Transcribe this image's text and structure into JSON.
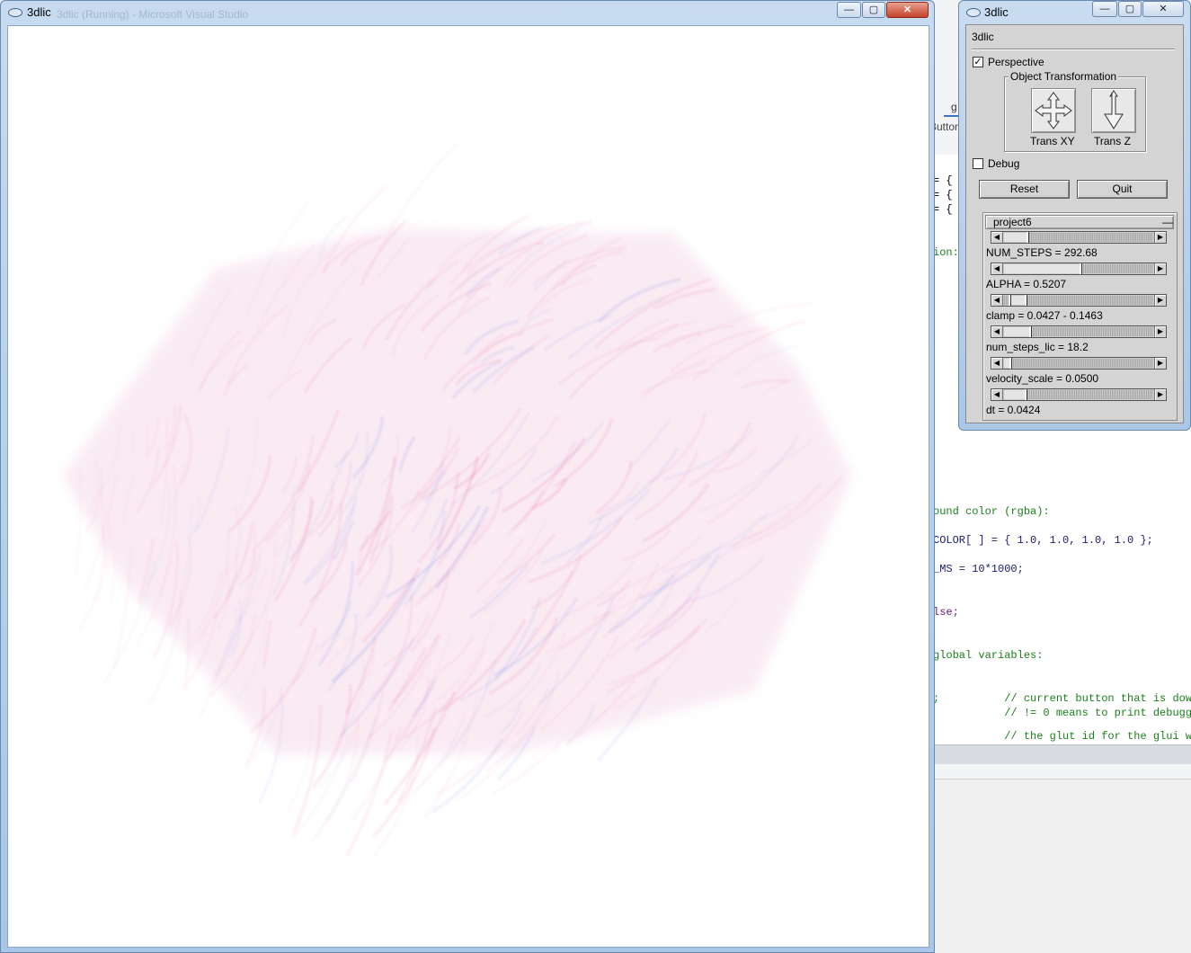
{
  "main_window": {
    "title": "3dlic",
    "ghost_title": "3dlic (Running) - Microsoft Visual Studio",
    "buttons": {
      "minimize": "—",
      "maximize": "▢",
      "close": "✕"
    }
  },
  "glui_window": {
    "title": "3dlic",
    "panel_title": "3dlic",
    "buttons": {
      "minimize": "—",
      "maximize": "▢",
      "close": "✕"
    },
    "perspective": {
      "label": "Perspective",
      "checked": true,
      "mark": "✓"
    },
    "transform_group": {
      "title": "Object Transformation",
      "trans_xy": "Trans XY",
      "trans_z": "Trans Z"
    },
    "debug": {
      "label": "Debug",
      "checked": false
    },
    "reset_label": "Reset",
    "quit_label": "Quit",
    "rollout": {
      "title": "project6",
      "collapse_glyph": "—",
      "sliders": [
        {
          "label": "NUM_STEPS = 292.68",
          "fraction": 0.16
        },
        {
          "label": "ALPHA = 0.5207",
          "fraction": 0.52
        },
        {
          "label": "clamp = 0.0427 - 0.1463",
          "fraction_low": 0.04,
          "fraction_high": 0.15
        },
        {
          "label": "num_steps_lic = 18.2",
          "fraction": 0.18
        },
        {
          "label": "velocity_scale = 0.0500",
          "fraction": 0.05
        },
        {
          "label": "dt = 0.0424",
          "fraction": 0.15
        }
      ],
      "arrow_left": "◀",
      "arrow_right": "▶"
    }
  },
  "vs_background": {
    "tab_fragment": "g",
    "button_fragment": "Button",
    "code": [
      {
        "text": "= {",
        "kind": "normal"
      },
      {
        "text": "= {",
        "kind": "normal"
      },
      {
        "text": "= {",
        "kind": "normal"
      },
      {
        "text": "ion:",
        "kind": "comment"
      },
      {
        "text": "ound color (rgba):",
        "kind": "comment"
      },
      {
        "text": "COLOR[ ] = { 1.0, 1.0, 1.0, 1.0 };",
        "kind": "normal"
      },
      {
        "text": "_MS = 10*1000;",
        "kind": "normal"
      },
      {
        "text": "lse;",
        "kind": "normal"
      },
      {
        "text": "global variables:",
        "kind": "comment"
      },
      {
        "text": ";          // current button that is dow",
        "kind": "mixed"
      },
      {
        "text": "           // != 0 means to print debugg",
        "kind": "comment"
      },
      {
        "text": "           // the glut id for the glui w",
        "kind": "comment"
      }
    ]
  },
  "visualization": {
    "description_colors": {
      "red": "#e0508a",
      "blue": "#5a6ee0",
      "background": "#ffffff"
    }
  }
}
